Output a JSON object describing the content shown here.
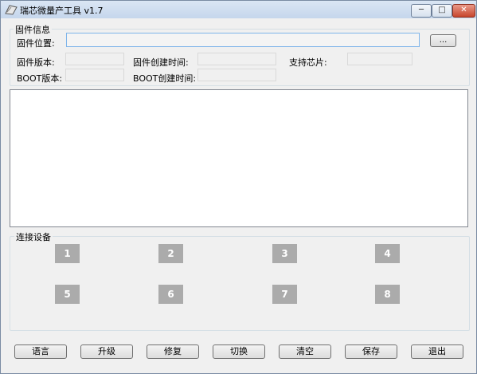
{
  "window": {
    "title": "瑞芯微量产工具 v1.7",
    "controls": {
      "minimize": "─",
      "maximize": "□",
      "close": "✕"
    }
  },
  "firmware_info": {
    "group_title": "固件信息",
    "path_label": "固件位置:",
    "path_value": "",
    "browse_label": "...",
    "version_label": "固件版本:",
    "version_value": "",
    "create_time_label": "固件创建时间:",
    "create_time_value": "",
    "chip_label": "支持芯片:",
    "chip_value": "",
    "boot_version_label": "BOOT版本:",
    "boot_version_value": "",
    "boot_create_time_label": "BOOT创建时间:",
    "boot_create_time_value": ""
  },
  "log": {
    "content": ""
  },
  "devices": {
    "group_title": "连接设备",
    "slots": [
      "1",
      "2",
      "3",
      "4",
      "5",
      "6",
      "7",
      "8"
    ]
  },
  "buttons": {
    "language": "语言",
    "upgrade": "升级",
    "repair": "修复",
    "switch": "切换",
    "clear": "清空",
    "save": "保存",
    "exit": "退出"
  },
  "colors": {
    "device_slot": "#ababab",
    "close_button": "#c7452c",
    "focus_border": "#7eb4ea"
  }
}
